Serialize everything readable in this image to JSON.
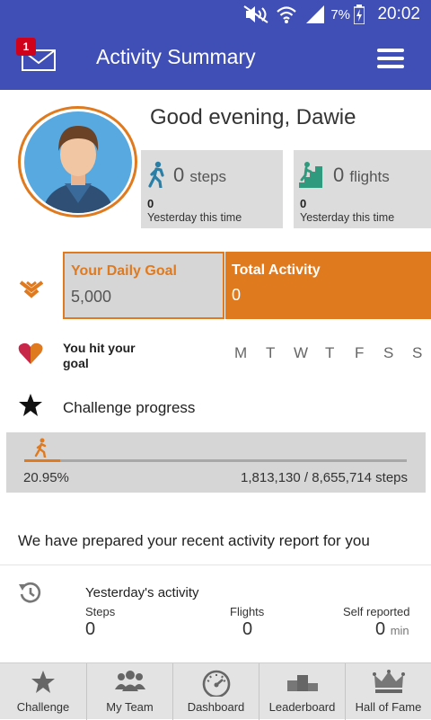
{
  "status_bar": {
    "battery_percent": "7%",
    "time": "20:02"
  },
  "app_bar": {
    "title": "Activity Summary",
    "mail_badge": "1"
  },
  "greeting": "Good evening, Dawie",
  "stats": [
    {
      "icon": "walking-person-icon",
      "value": "0",
      "unit": "steps",
      "yesterday_value": "0",
      "yesterday_label": "Yesterday this time"
    },
    {
      "icon": "stairs-person-icon",
      "value": "0",
      "unit": "flights",
      "yesterday_value": "0",
      "yesterday_label": "Yesterday this time"
    }
  ],
  "daily_goal": {
    "label": "Your Daily Goal",
    "value": "5,000"
  },
  "total_activity": {
    "label": "Total Activity",
    "value": "0"
  },
  "hit_goal": {
    "label": "You hit your goal",
    "days": [
      "M",
      "T",
      "W",
      "T",
      "F",
      "S",
      "S"
    ]
  },
  "challenge": {
    "title": "Challenge progress",
    "percent_label": "20.95%",
    "progress_fraction": 0.2095,
    "steps_label": "1,813,130 / 8,655,714 steps"
  },
  "report_message": "We have prepared your recent activity report for you",
  "yesterday": {
    "title": "Yesterday's activity",
    "steps_label": "Steps",
    "steps_value": "0",
    "flights_label": "Flights",
    "flights_value": "0",
    "self_label": "Self reported",
    "self_value": "0",
    "self_unit": "min"
  },
  "bottom_nav": [
    {
      "label": "Challenge",
      "icon": "star-icon"
    },
    {
      "label": "My Team",
      "icon": "team-icon"
    },
    {
      "label": "Dashboard",
      "icon": "speedometer-icon"
    },
    {
      "label": "Leaderboard",
      "icon": "podium-icon"
    },
    {
      "label": "Hall of Fame",
      "icon": "crown-icon"
    }
  ],
  "colors": {
    "primary": "#3f4fb5",
    "accent": "#e07a1f",
    "panel": "#d6d6d6"
  }
}
